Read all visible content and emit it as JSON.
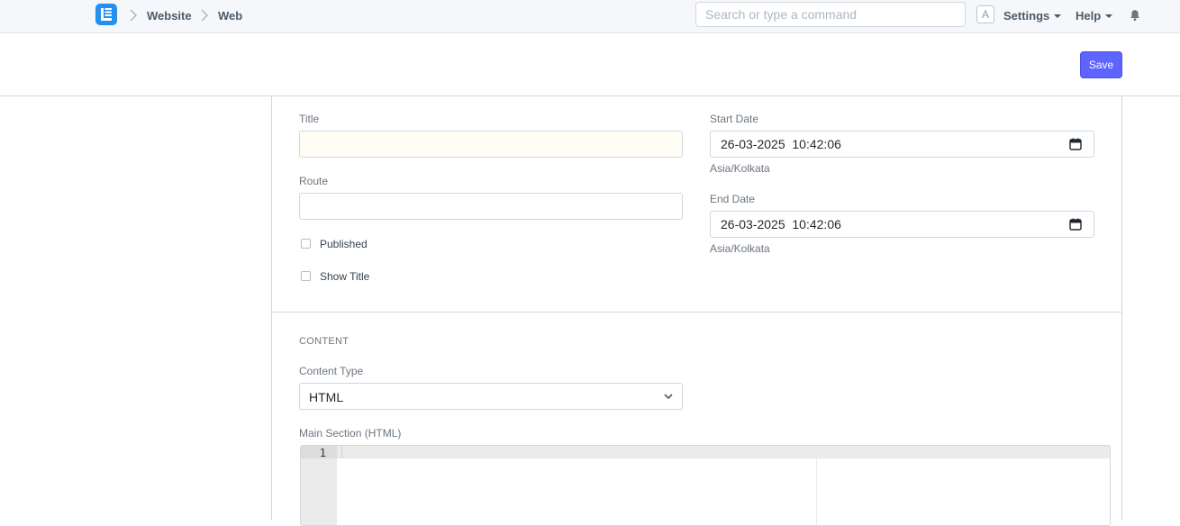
{
  "navbar": {
    "breadcrumbs": [
      "Website",
      "Web"
    ],
    "search_placeholder": "Search or type a command",
    "avatar_letter": "A",
    "settings_label": "Settings",
    "help_label": "Help"
  },
  "page_header": {
    "save_label": "Save"
  },
  "form": {
    "title_label": "Title",
    "title_value": "",
    "route_label": "Route",
    "route_value": "",
    "published_label": "Published",
    "published_checked": false,
    "show_title_label": "Show Title",
    "show_title_checked": false,
    "start_date_label": "Start Date",
    "start_date_value": "26-03-2025  10:42:06",
    "start_date_tz": "Asia/Kolkata",
    "end_date_label": "End Date",
    "end_date_value": "26-03-2025  10:42:06",
    "end_date_tz": "Asia/Kolkata"
  },
  "content_section": {
    "title": "CONTENT",
    "content_type_label": "Content Type",
    "content_type_value": "HTML",
    "main_section_label": "Main Section (HTML)",
    "editor_line_number": "1"
  },
  "icons": {
    "logo": "frappe-logo-icon",
    "breadcrumb_separator": "chevron-right-icon",
    "notifications": "bell-icon",
    "calendar": "calendar-icon",
    "select": "chevron-down-icon"
  },
  "colors": {
    "primary": "#5e64ff",
    "logo": "#2490ef",
    "navbar_bg": "#f5f7fa",
    "title_input_bg": "#fffdf4"
  }
}
